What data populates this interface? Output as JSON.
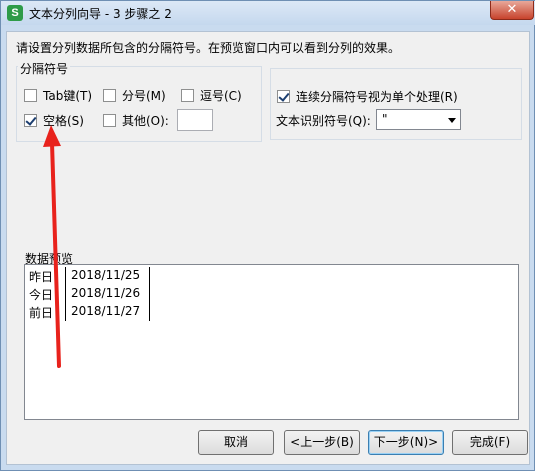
{
  "window": {
    "title": "文本分列向导 - 3 步骤之 2",
    "app_icon_text": "S",
    "close_symbol": "✕"
  },
  "instruction": "请设置分列数据所包含的分隔符号。在预览窗口内可以看到分列的效果。",
  "delimiters": {
    "group_title": "分隔符号",
    "tab": {
      "label": "Tab键(T)",
      "checked": false
    },
    "semicolon": {
      "label": "分号(M)",
      "checked": false
    },
    "comma": {
      "label": "逗号(C)",
      "checked": false
    },
    "space": {
      "label": "空格(S)",
      "checked": true
    },
    "other": {
      "label": "其他(O):",
      "checked": false,
      "value": ""
    }
  },
  "options": {
    "consecutive": {
      "label": "连续分隔符号视为单个处理(R)",
      "checked": true
    },
    "qualifier_label": "文本识别符号(Q):",
    "qualifier_value": "\""
  },
  "preview": {
    "label": "数据预览",
    "rows": [
      {
        "c1": "昨日",
        "c2": "2018/11/25"
      },
      {
        "c1": "今日",
        "c2": "2018/11/26"
      },
      {
        "c1": "前日",
        "c2": "2018/11/27"
      }
    ]
  },
  "buttons": {
    "cancel": "取消",
    "back": "<上一步(B)",
    "next": "下一步(N)>",
    "finish": "完成(F)"
  },
  "colors": {
    "annotation_arrow": "#e8221c"
  }
}
